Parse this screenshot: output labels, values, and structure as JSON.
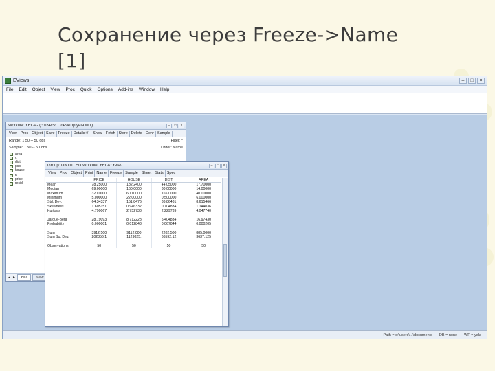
{
  "slide": {
    "title_line1": "Сохранение через Freeze->Name",
    "title_line2": "[1]"
  },
  "app": {
    "title": "EViews",
    "menu": [
      "File",
      "Edit",
      "Object",
      "View",
      "Proc",
      "Quick",
      "Options",
      "Add-ins",
      "Window",
      "Help"
    ],
    "status": [
      "Path = c:\\users\\...\\documents",
      "DB = none",
      "WF = yela"
    ],
    "win_controls": [
      "–",
      "□",
      "×"
    ]
  },
  "workfile": {
    "title": "Workfile: YELA - (c:\\users\\...\\desktop\\yela.wf1)",
    "toolbar": [
      "View",
      "Proc",
      "Object",
      "Save",
      "Freeze",
      "Details+/-",
      "Show",
      "Fetch",
      "Store",
      "Delete",
      "Genr",
      "Sample"
    ],
    "range": "Range:  1 50  --  50 obs",
    "filter": "Filter: *",
    "sample": "Sample: 1 50  --  50 obs",
    "order": "Order: Name",
    "objects": [
      "area",
      "c",
      "dist",
      "pco",
      "house",
      "n",
      "price",
      "resid"
    ],
    "tabs": [
      "Yela",
      "New"
    ]
  },
  "group": {
    "title": "Group: UNTITLED   Workfile: YELA::Yela\\",
    "toolbar": [
      "View",
      "Proc",
      "Object",
      "Print",
      "Name",
      "Freeze",
      "Sample",
      "Sheet",
      "Stats",
      "Spec"
    ],
    "columns": [
      "",
      "PRICE",
      "HOUSE",
      "DIST",
      "AREA"
    ],
    "rows": [
      [
        "Mean",
        "78.25000",
        "182.2400",
        "44.05000",
        "17.70000"
      ],
      [
        "Median",
        "69.00000",
        "160.0000",
        "30.00000",
        "14.00000"
      ],
      [
        "Maximum",
        "320.0000",
        "600.0000",
        "165.0000",
        "40.00000"
      ],
      [
        "Minimum",
        "5.000000",
        "22.00000",
        "0.500000",
        "6.000000"
      ],
      [
        "Std. Dev.",
        "64.34337",
        "151.8476",
        "36.86481",
        "8.615466"
      ],
      [
        "Skewness",
        "1.605151",
        "0.946332",
        "0.704834",
        "1.144036"
      ],
      [
        "Kurtosis",
        "4.790067",
        "2.752738",
        "2.229739",
        "4.047740"
      ],
      [],
      [
        "Jarque-Bera",
        "28.19093",
        "8.712228",
        "5.404834",
        "16.97430"
      ],
      [
        "Probability",
        "0.000001",
        "0.012848",
        "0.067044",
        "0.000205"
      ],
      [],
      [
        "Sum",
        "3912.500",
        "9112.000",
        "2202.500",
        "885.0000"
      ],
      [
        "Sum Sq. Dev.",
        "202856.1",
        "1129825.",
        "66592.12",
        "3637.125"
      ],
      [],
      [
        "Observations",
        "50",
        "50",
        "50",
        "50"
      ]
    ]
  },
  "colors": {
    "slide_bg": "#fbf8e6",
    "workspace": "#b9cde5",
    "window_border": "#7d93b5"
  }
}
